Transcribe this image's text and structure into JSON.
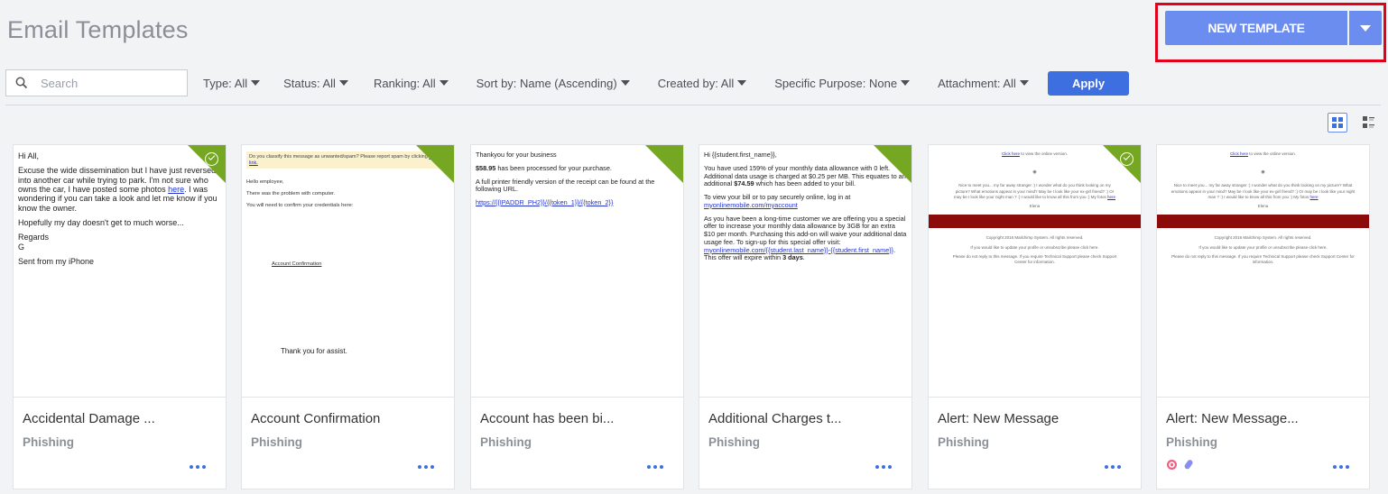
{
  "title": "Email Templates",
  "new_template": {
    "label": "NEW TEMPLATE"
  },
  "search": {
    "placeholder": "Search",
    "value": ""
  },
  "filters": [
    {
      "label": "Type: All"
    },
    {
      "label": "Status: All"
    },
    {
      "label": "Ranking: All"
    },
    {
      "label": "Sort by: Name (Ascending)"
    },
    {
      "label": "Created by: All"
    },
    {
      "label": "Specific Purpose: None"
    },
    {
      "label": "Attachment: All"
    }
  ],
  "apply_label": "Apply",
  "colors": {
    "accent": "#3d6fe0",
    "new_button": "#6b8df0",
    "corner": "#76a723",
    "highlight": "#e3001b"
  },
  "cards": [
    {
      "title": "Accidental Damage ...",
      "category": "Phishing",
      "checked": true,
      "preview": {
        "greeting": "Hi All,",
        "p1": "Excuse the wide dissemination but I have just reversed into another car while trying to park. I'm not sure who owns the car, I have posted some photos",
        "link": "here",
        "p1b": ". I was wondering if you can take a look and let me know if you know the owner.",
        "p2": "Hopefully my day doesn't get to much worse...",
        "p3": "Regards",
        "p4": "G",
        "p5": "Sent from my iPhone"
      }
    },
    {
      "title": "Account Confirmation",
      "category": "Phishing",
      "checked": false,
      "preview": {
        "banner": "Do you classify this message as unwanted/spam? Please report spam by clicking",
        "banner_link": "this link.",
        "l1": "Hello employee,",
        "l2": "There was the problem with computer.",
        "l3": "You will need to confirm your credentials here:",
        "link": "Account Confirmation",
        "footer": "Thank you for assist."
      }
    },
    {
      "title": "Account has been bi...",
      "category": "Phishing",
      "checked": false,
      "preview": {
        "l1": "Thankyou for your business",
        "amount": "$58.95",
        "l2": " has been processed for your purchase.",
        "l3": "A full printer friendly version of the receipt can be found at the following URL.",
        "link": "https://{{IPADDR_PH2}}/{{token_1}}/{{token_2}}"
      }
    },
    {
      "title": "Additional Charges t...",
      "category": "Phishing",
      "checked": false,
      "preview": {
        "l1": "Hi {{student.first_name}},",
        "l2a": "You have used 159% of your monthly data allowance with 0 left. Additional data usage is charged at $0.25 per MB. This equates to an additional ",
        "l2b": "$74.59",
        "l2c": " which has been added to your bill.",
        "l3": "To view your bill or to pay securely online, log in at",
        "link1": "myonlinemobile.com/myaccount",
        "l4": "As you have been a long-time customer we are offering you a special offer to increase your monthly data allowance by 3GB for an extra $10 per month. Purchasing this add-on will waive your additional data usage fee. To sign-up for this special offer visit:",
        "link2": "myonlinemobile.com/{{student.last_name}}-{{student.first_name}}",
        "l5": ". This offer will expire within ",
        "l5b": "3 days",
        "l5c": "."
      }
    },
    {
      "title": "Alert: New Message",
      "category": "Phishing",
      "checked": true,
      "preview": {
        "top_link": "Click here",
        "top": " to view the online version.",
        "mid": "Nice to meet you... my far away stranger :) I wonder what do you think looking on my picture? What emotions appear in your mind? May be I look like your ex-girl friend? :) Or may be I look like your night man ? :) I would like to know all this from you :) My fotos",
        "mid_link": "here",
        "sign": "Elena",
        "f1": "Copyright 2016 Mailchimp System. All rights reserved.",
        "f2": "If you would like to update your profile or unsubscribe please click here.",
        "f3": "Please do not reply to this message. If you require Technical Support please check Support Center for information."
      }
    },
    {
      "title": "Alert: New Message...",
      "category": "Phishing",
      "checked": false,
      "preview": {
        "top_link": "Click here",
        "top": " to view the online version.",
        "mid": "Nice to meet you... my far away stranger :) I wonder what do you think looking on my picture? What emotions appear in your mind? May be I look like your ex-girl friend? :) Or may be I look like your night man ? :) I would like to know all this from you :) My fotos",
        "mid_link": "here",
        "sign": "Elena",
        "f1": "Copyright 2016 Mailchimp System. All rights reserved.",
        "f2": "If you would like to update your profile or unsubscribe please click here.",
        "f3": "Please do not reply to this message. If you require Technical Support please check Support Center for information."
      }
    }
  ]
}
